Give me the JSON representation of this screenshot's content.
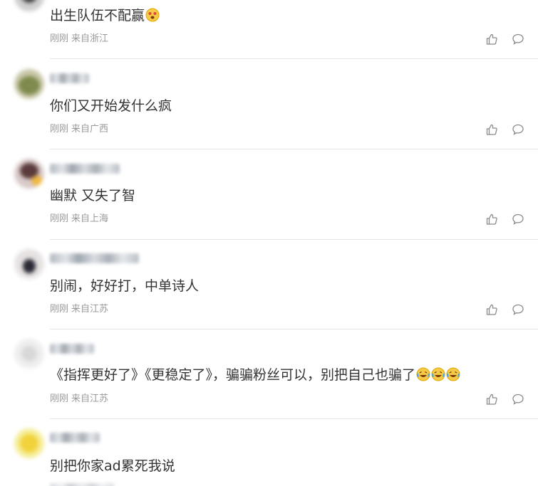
{
  "comments": [
    {
      "text": "出生队伍不配赢",
      "emoji": "surprised-face-emoji",
      "time": "刚刚",
      "location": "来自浙江"
    },
    {
      "text": "你们又开始发什么疯",
      "emoji": "",
      "time": "刚刚",
      "location": "来自广西"
    },
    {
      "text": "幽默 又失了智",
      "emoji": "",
      "time": "刚刚",
      "location": "来自上海"
    },
    {
      "text": "别闹，好好打，中单诗人",
      "emoji": "",
      "time": "刚刚",
      "location": "来自江苏"
    },
    {
      "text": "《指挥更好了》《更稳定了》，骗骗粉丝可以，别把自己也骗了",
      "emoji": "laughing-crying-emoji x3",
      "time": "刚刚",
      "location": "来自江苏"
    },
    {
      "text": "别把你家ad累死我说",
      "emoji": "",
      "time": "",
      "location": ""
    }
  ],
  "icons": {
    "like": "thumbs-up-icon",
    "reply": "comment-bubble-icon"
  },
  "colors": {
    "text": "#333333",
    "meta": "#999999",
    "divider": "#e6e6e6",
    "icon": "#8a8a8a"
  }
}
